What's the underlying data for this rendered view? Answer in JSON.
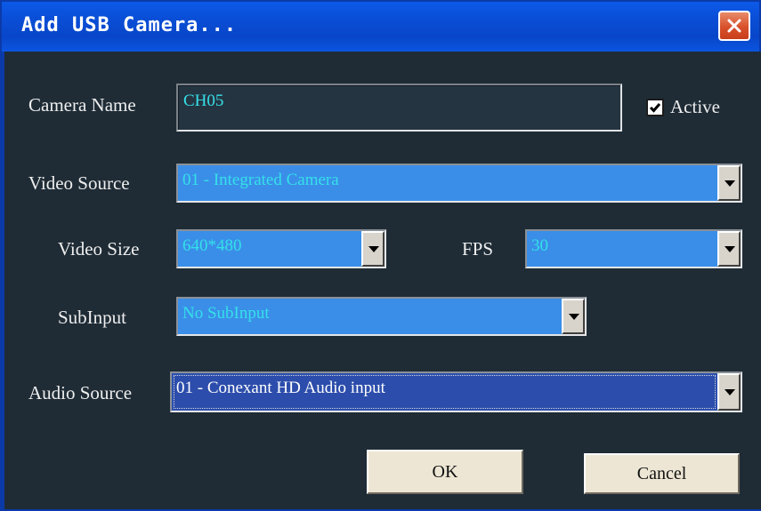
{
  "window": {
    "title": "Add USB Camera..."
  },
  "form": {
    "camera_name": {
      "label": "Camera Name",
      "value": "CH05"
    },
    "active": {
      "label": "Active",
      "checked": true
    },
    "video_source": {
      "label": "Video Source",
      "value": "01 - Integrated Camera"
    },
    "video_size": {
      "label": "Video Size",
      "value": "640*480"
    },
    "fps": {
      "label": "FPS",
      "value": "30"
    },
    "subinput": {
      "label": "SubInput",
      "value": "No SubInput"
    },
    "audio_source": {
      "label": "Audio Source",
      "value": "01 - Conexant HD Audio input"
    }
  },
  "buttons": {
    "ok": "OK",
    "cancel": "Cancel"
  },
  "colors": {
    "titlebar": "#0a4fd8",
    "background": "#1f2c36",
    "combo": "#3a8ee8",
    "value_text": "#35e0e8",
    "close": "#d8512b"
  },
  "icons": {
    "close": "close-icon",
    "check": "check-icon",
    "dropdown": "chevron-down-icon"
  }
}
